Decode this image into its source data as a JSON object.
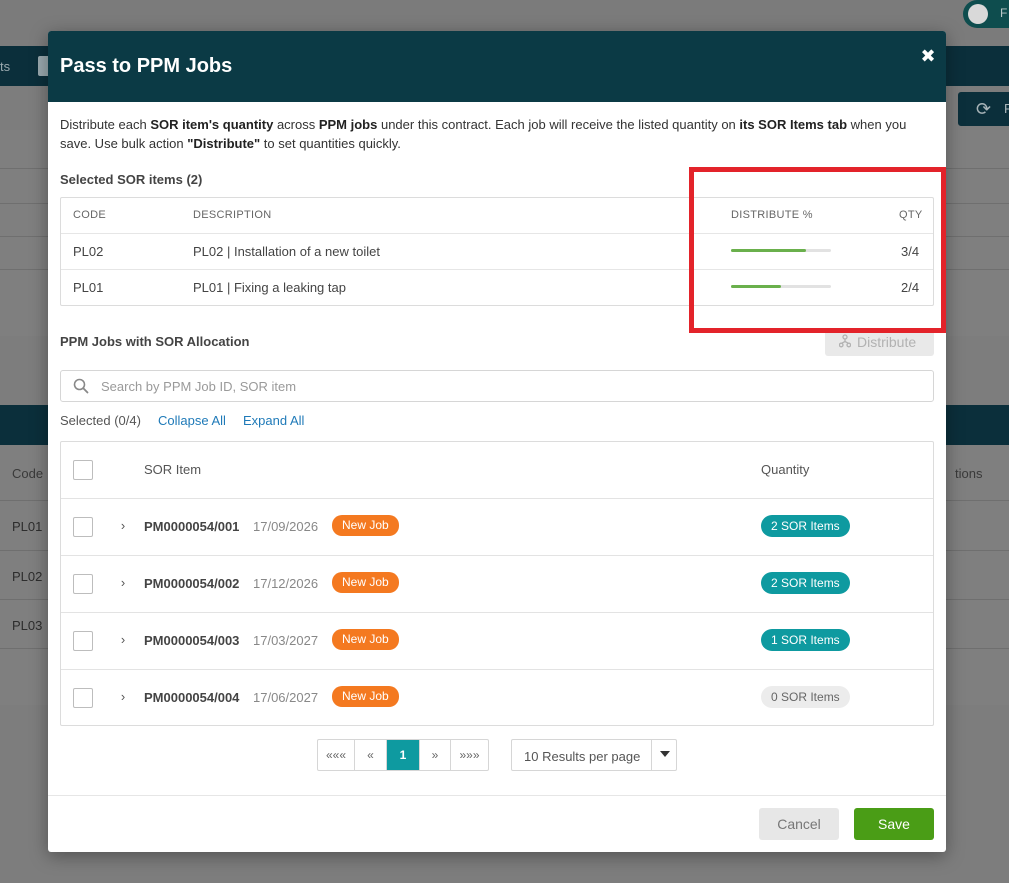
{
  "background": {
    "pill_text": "F",
    "nav_text": "ts",
    "refresh_btn_text": "F",
    "table_header_code": "Code",
    "table_header_actions": "tions",
    "rows": [
      "PL01",
      "PL02",
      "PL03"
    ]
  },
  "modal": {
    "title": "Pass to PPM Jobs",
    "close_glyph": "✖",
    "intro": {
      "p1": "Distribute each ",
      "b1": "SOR item's quantity",
      "p2": " across ",
      "b2": "PPM jobs",
      "p3": " under this contract. Each job will receive the listed quantity on ",
      "b3": "its SOR Items tab",
      "p4": " when you save. Use bulk action ",
      "b4": "\"Distribute\"",
      "p5": " to set quantities quickly."
    },
    "selected_sor_label": "Selected SOR items (2)",
    "sor_table": {
      "headers": {
        "code": "CODE",
        "description": "DESCRIPTION",
        "distribute": "DISTRIBUTE %",
        "qty": "QTY"
      },
      "rows": [
        {
          "code": "PL02",
          "description": "PL02 | Installation of a new toilet",
          "distribute_fraction": 0.75,
          "qty": "3/4"
        },
        {
          "code": "PL01",
          "description": "PL01 | Fixing a leaking tap",
          "distribute_fraction": 0.5,
          "qty": "2/4"
        }
      ]
    },
    "ppm_label": "PPM Jobs with SOR Allocation",
    "distribute_button": "Distribute",
    "search": {
      "placeholder": "Search by PPM Job ID, SOR item",
      "value": ""
    },
    "selected_count": "Selected (0/4)",
    "collapse_all": "Collapse All",
    "expand_all": "Expand All",
    "jobs_table": {
      "headers": {
        "sor_item": "SOR Item",
        "quantity": "Quantity"
      },
      "rows": [
        {
          "id": "PM0000054/001",
          "date": "17/09/2026",
          "status": "New Job",
          "sor_items": "2 SOR Items",
          "has_items": true
        },
        {
          "id": "PM0000054/002",
          "date": "17/12/2026",
          "status": "New Job",
          "sor_items": "2 SOR Items",
          "has_items": true
        },
        {
          "id": "PM0000054/003",
          "date": "17/03/2027",
          "status": "New Job",
          "sor_items": "1 SOR Items",
          "has_items": true
        },
        {
          "id": "PM0000054/004",
          "date": "17/06/2027",
          "status": "New Job",
          "sor_items": "0 SOR Items",
          "has_items": false
        }
      ]
    },
    "pagination": {
      "first": "«««",
      "prev": "«",
      "current": "1",
      "next": "»",
      "last": "»»»",
      "per_page": "10 Results per page"
    },
    "cancel_button": "Cancel",
    "save_button": "Save"
  },
  "colors": {
    "header_bg": "#0b3a45",
    "teal": "#0e9aa0",
    "orange": "#f47920",
    "green": "#4a9d16",
    "progress": "#6ab04c",
    "highlight": "#e3232a"
  }
}
